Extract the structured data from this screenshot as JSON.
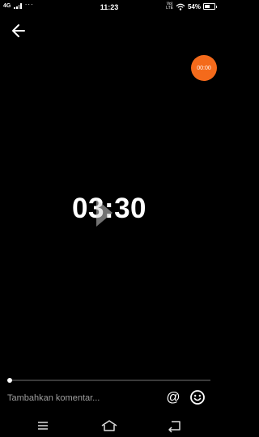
{
  "status_bar": {
    "network": "4G",
    "time": "11:23",
    "volte_top": "Vo)",
    "volte_bottom": "LTE",
    "battery_percent": "54%",
    "battery_level": 0.54
  },
  "timer_bubble": {
    "label": "00:00",
    "color": "#f46a1b"
  },
  "countdown": {
    "value": "03:30"
  },
  "progress": {
    "fraction": 0.01
  },
  "comment": {
    "placeholder": "Tambahkan komentar..."
  },
  "icons": {
    "back": "arrow-left-icon",
    "mention": "at-icon",
    "emoji": "emoji-icon",
    "nav_menu": "menu-icon",
    "nav_home": "home-icon",
    "nav_back": "back-icon"
  },
  "mention_glyph": "@"
}
